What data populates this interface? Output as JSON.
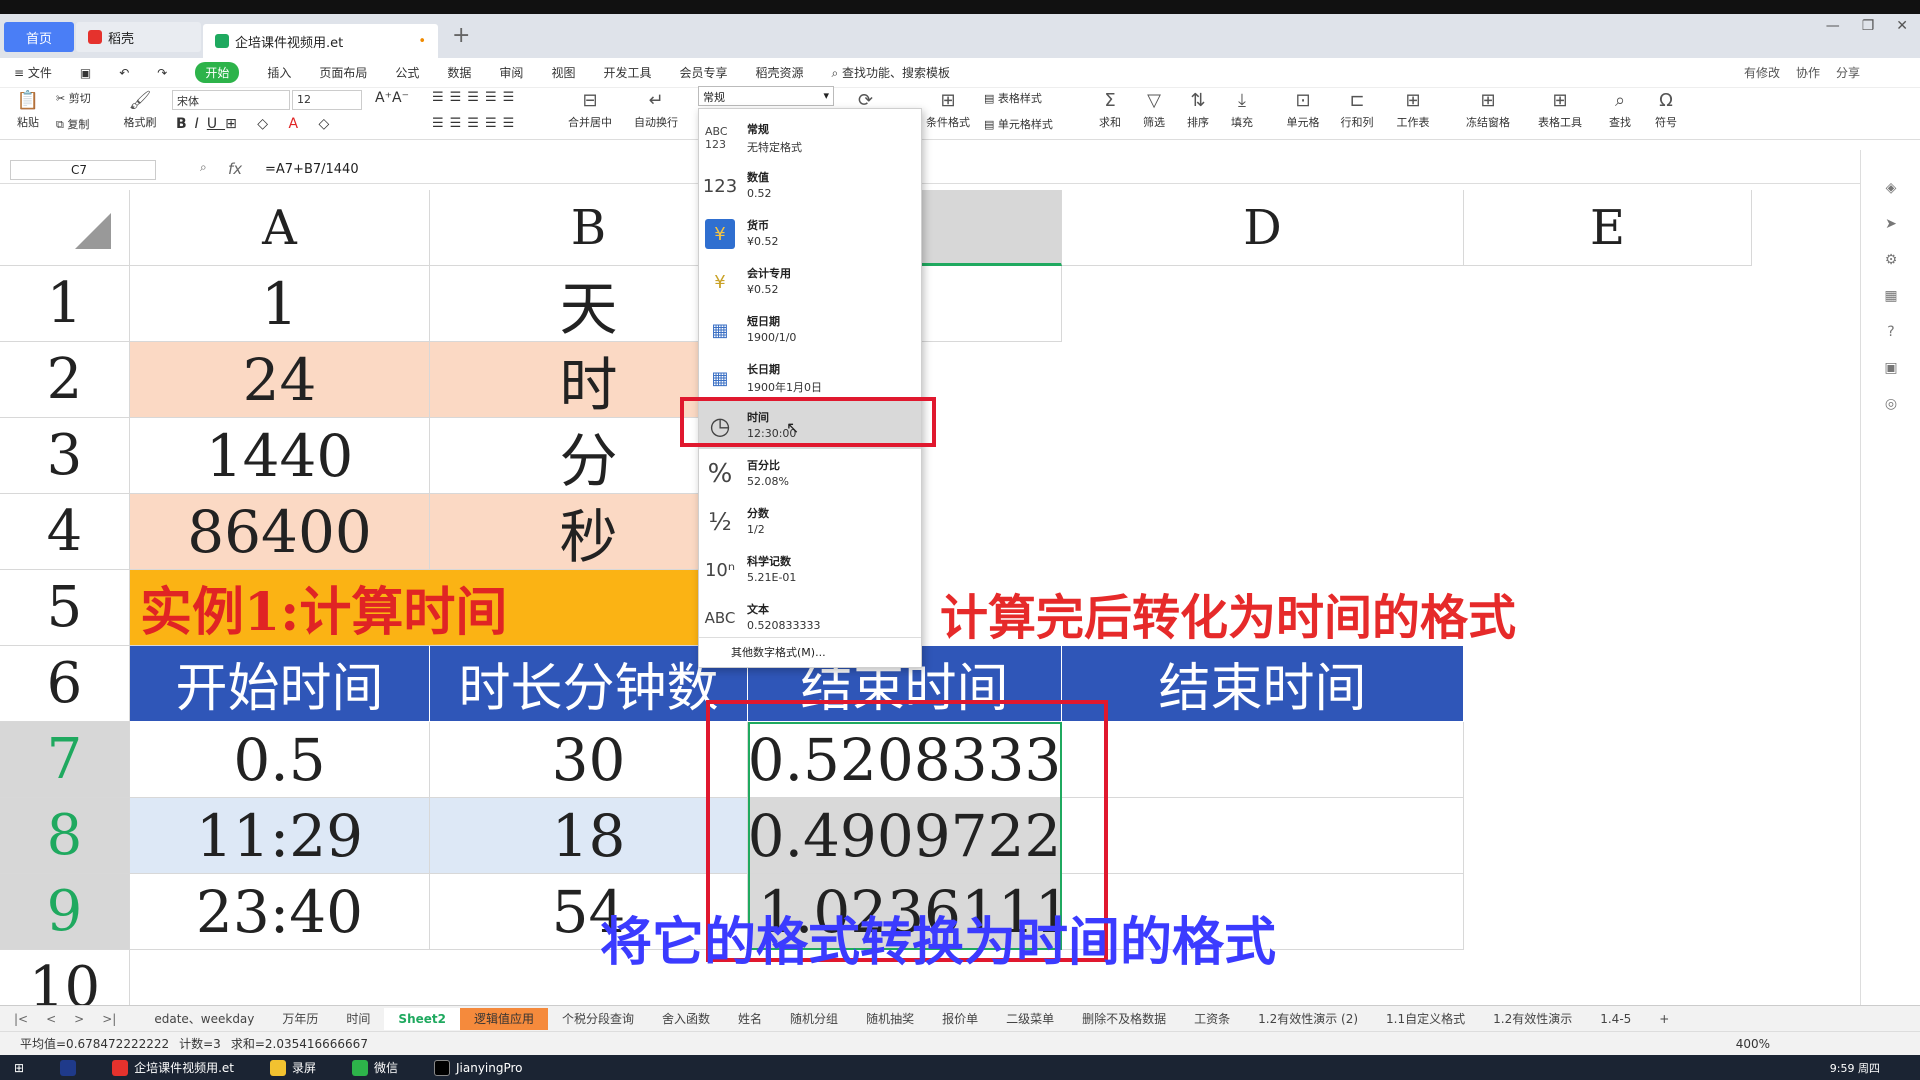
{
  "tabs": {
    "home": "首页",
    "wps": "稻壳",
    "doc": "企培课件视频用.et",
    "dot": "•",
    "new": "+"
  },
  "window_controls": [
    "—",
    "❐",
    "✕"
  ],
  "menu": {
    "hamburger": "≡ 文件",
    "items": [
      "开始",
      "插入",
      "页面布局",
      "公式",
      "数据",
      "审阅",
      "视图",
      "开发工具",
      "会员专享",
      "稻壳资源"
    ],
    "search": "查找功能、搜索模板",
    "right": [
      "有修改",
      "协作",
      "分享"
    ]
  },
  "ribbon": {
    "paste": "粘贴",
    "cut": "剪切",
    "copy": "复制",
    "format_painter": "格式刷",
    "font_name": "宋体",
    "font_size": "12",
    "merge": "合并居中",
    "wrap": "自动换行",
    "cond_format": "条件格式",
    "table_style": "表格样式",
    "cell_style": "单元格样式",
    "sum": "求和",
    "filter": "筛选",
    "sort": "排序",
    "fill": "填充",
    "cell": "单元格",
    "rowcol": "行和列",
    "worksheet": "工作表",
    "freeze": "冻结窗格",
    "table_tools": "表格工具",
    "find": "查找",
    "symbol": "符号"
  },
  "formula_bar": {
    "cell_ref": "C7",
    "fx": "fx",
    "formula": "=A7+B7/1440"
  },
  "columns": [
    "A",
    "B",
    "C",
    "D",
    "E"
  ],
  "rows": [
    "1",
    "2",
    "3",
    "4",
    "5",
    "6",
    "7",
    "8",
    "9",
    "10"
  ],
  "cells": {
    "a1": "1",
    "b1": "天",
    "a2": "24",
    "b2": "时",
    "a3": "1440",
    "b3": "分",
    "a4": "86400",
    "b4": "秒",
    "a5": "实例1:计算时间",
    "a6": "开始时间",
    "b6": "时长分钟数",
    "c6": "结束时间",
    "d6": "结束时间",
    "a7": "0.5",
    "b7": "30",
    "c7": "0.5208333",
    "a8": "11:29",
    "b8": "18",
    "c8": "0.4909722",
    "a9": "23:40",
    "b9": "54",
    "c9": "1.0236111"
  },
  "annotations": {
    "note1": "计算完后转化为时间的格式",
    "note2": "将它的格式转换为时间的格式"
  },
  "number_format": {
    "current": "常规",
    "items": [
      {
        "icon": "ABC 123",
        "name": "常规",
        "sample": "无特定格式"
      },
      {
        "icon": "123",
        "name": "数值",
        "sample": "0.52"
      },
      {
        "icon": "¥",
        "name": "货币",
        "sample": "¥0.52"
      },
      {
        "icon": "¥",
        "name": "会计专用",
        "sample": "¥0.52"
      },
      {
        "icon": "▦",
        "name": "短日期",
        "sample": "1900/1/0"
      },
      {
        "icon": "▦",
        "name": "长日期",
        "sample": "1900年1月0日"
      },
      {
        "icon": "◷",
        "name": "时间",
        "sample": "12:30:00"
      },
      {
        "icon": "%",
        "name": "百分比",
        "sample": "52.08%"
      },
      {
        "icon": "½",
        "name": "分数",
        "sample": "1/2"
      },
      {
        "icon": "10ⁿ",
        "name": "科学记数",
        "sample": "5.21E-01"
      },
      {
        "icon": "ABC",
        "name": "文本",
        "sample": "0.520833333"
      }
    ],
    "more": "其他数字格式(M)..."
  },
  "sheet_tabs": [
    "edate、weekday",
    "万年历",
    "时间",
    "Sheet2",
    "逻辑值应用",
    "个税分段查询",
    "舍入函数",
    "姓名",
    "随机分组",
    "随机抽奖",
    "报价单",
    "二级菜单",
    "删除不及格数据",
    "工资条",
    "1.2有效性演示 (2)",
    "1.1自定义格式",
    "1.2有效性演示",
    "1.4-5"
  ],
  "status": {
    "avg": "平均值=0.678472222222",
    "count": "计数=3",
    "sum": "求和=2.035416666667",
    "zoom": "400%"
  },
  "taskbar": {
    "items": [
      "企培课件视频用.et",
      "录屏",
      "微信",
      "JianyingPro"
    ],
    "clock": "9:59 周四"
  }
}
